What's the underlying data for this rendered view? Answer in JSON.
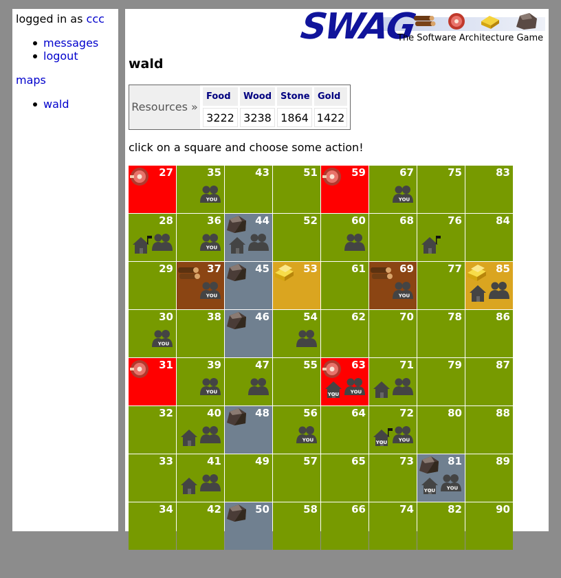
{
  "sidebar": {
    "logged_in_prefix": "logged in as",
    "username": "ccc",
    "links": [
      "messages",
      "logout"
    ],
    "maps_heading": "maps",
    "maps": [
      "wald"
    ]
  },
  "banner": {
    "logo": "SWAG",
    "tagline": "The Software Architecture Game"
  },
  "map_title": "wald",
  "resources": {
    "label": "Resources »",
    "items": [
      {
        "name": "Food",
        "value": "3222"
      },
      {
        "name": "Wood",
        "value": "3238"
      },
      {
        "name": "Stone",
        "value": "1864"
      },
      {
        "name": "Gold",
        "value": "1422"
      }
    ]
  },
  "instruction": "click on a square and choose some action!",
  "colors": {
    "grass": "#779a00",
    "food": "#ff0000",
    "wood": "#8b4513",
    "stone": "#708090",
    "gold": "#daa520",
    "link": "#0000cc",
    "logo": "#10149b"
  },
  "grid": {
    "columns": [
      [
        {
          "n": "27",
          "t": "food",
          "res": "meat-icon"
        },
        {
          "n": "28",
          "t": "grass",
          "house": "house-flag",
          "units": "group"
        },
        {
          "n": "29",
          "t": "grass"
        },
        {
          "n": "30",
          "t": "grass",
          "units": "group-you"
        },
        {
          "n": "31",
          "t": "food",
          "res": "meat-icon"
        },
        {
          "n": "32",
          "t": "grass"
        },
        {
          "n": "33",
          "t": "grass"
        },
        {
          "n": "34",
          "t": "grass"
        }
      ],
      [
        {
          "n": "35",
          "t": "grass",
          "units": "group-you"
        },
        {
          "n": "36",
          "t": "grass",
          "units": "group-you"
        },
        {
          "n": "37",
          "t": "wood",
          "res": "wood-icon",
          "units": "group-you"
        },
        {
          "n": "38",
          "t": "grass"
        },
        {
          "n": "39",
          "t": "grass",
          "units": "group-you"
        },
        {
          "n": "40",
          "t": "grass",
          "house": "house",
          "units": "group"
        },
        {
          "n": "41",
          "t": "grass",
          "house": "house",
          "units": "group"
        },
        {
          "n": "42",
          "t": "grass"
        }
      ],
      [
        {
          "n": "43",
          "t": "grass"
        },
        {
          "n": "44",
          "t": "stone",
          "res": "stone-icon",
          "house": "house",
          "units": "group"
        },
        {
          "n": "45",
          "t": "stone",
          "res": "stone-icon"
        },
        {
          "n": "46",
          "t": "stone",
          "res": "stone-icon"
        },
        {
          "n": "47",
          "t": "grass",
          "units": "group"
        },
        {
          "n": "48",
          "t": "stone",
          "res": "stone-icon"
        },
        {
          "n": "49",
          "t": "grass"
        },
        {
          "n": "50",
          "t": "stone",
          "res": "stone-icon"
        }
      ],
      [
        {
          "n": "51",
          "t": "grass"
        },
        {
          "n": "52",
          "t": "grass"
        },
        {
          "n": "53",
          "t": "gold",
          "res": "gold-icon"
        },
        {
          "n": "54",
          "t": "grass",
          "units": "group"
        },
        {
          "n": "55",
          "t": "grass"
        },
        {
          "n": "56",
          "t": "grass",
          "units": "group-you"
        },
        {
          "n": "57",
          "t": "grass"
        },
        {
          "n": "58",
          "t": "grass"
        }
      ],
      [
        {
          "n": "59",
          "t": "food",
          "res": "meat-icon"
        },
        {
          "n": "60",
          "t": "grass",
          "units": "group"
        },
        {
          "n": "61",
          "t": "grass"
        },
        {
          "n": "62",
          "t": "grass"
        },
        {
          "n": "63",
          "t": "food",
          "res": "meat-icon",
          "house": "house-you",
          "units": "group-you"
        },
        {
          "n": "64",
          "t": "grass"
        },
        {
          "n": "65",
          "t": "grass"
        },
        {
          "n": "66",
          "t": "grass"
        }
      ],
      [
        {
          "n": "67",
          "t": "grass",
          "units": "group-you"
        },
        {
          "n": "68",
          "t": "grass"
        },
        {
          "n": "69",
          "t": "wood",
          "res": "wood-icon",
          "units": "group-you"
        },
        {
          "n": "70",
          "t": "grass"
        },
        {
          "n": "71",
          "t": "grass",
          "house": "house",
          "units": "group"
        },
        {
          "n": "72",
          "t": "grass",
          "house": "house-flag-you",
          "units": "group-you"
        },
        {
          "n": "73",
          "t": "grass"
        },
        {
          "n": "74",
          "t": "grass"
        }
      ],
      [
        {
          "n": "75",
          "t": "grass"
        },
        {
          "n": "76",
          "t": "grass",
          "house": "house-flag"
        },
        {
          "n": "77",
          "t": "grass"
        },
        {
          "n": "78",
          "t": "grass"
        },
        {
          "n": "79",
          "t": "grass"
        },
        {
          "n": "80",
          "t": "grass"
        },
        {
          "n": "81",
          "t": "stone",
          "res": "stone-icon",
          "house": "house-you",
          "units": "group-you"
        },
        {
          "n": "82",
          "t": "grass"
        }
      ],
      [
        {
          "n": "83",
          "t": "grass"
        },
        {
          "n": "84",
          "t": "grass"
        },
        {
          "n": "85",
          "t": "gold",
          "res": "gold-icon",
          "house": "house",
          "units": "group"
        },
        {
          "n": "86",
          "t": "grass"
        },
        {
          "n": "87",
          "t": "grass"
        },
        {
          "n": "88",
          "t": "grass"
        },
        {
          "n": "89",
          "t": "grass"
        },
        {
          "n": "90",
          "t": "grass"
        }
      ]
    ]
  }
}
